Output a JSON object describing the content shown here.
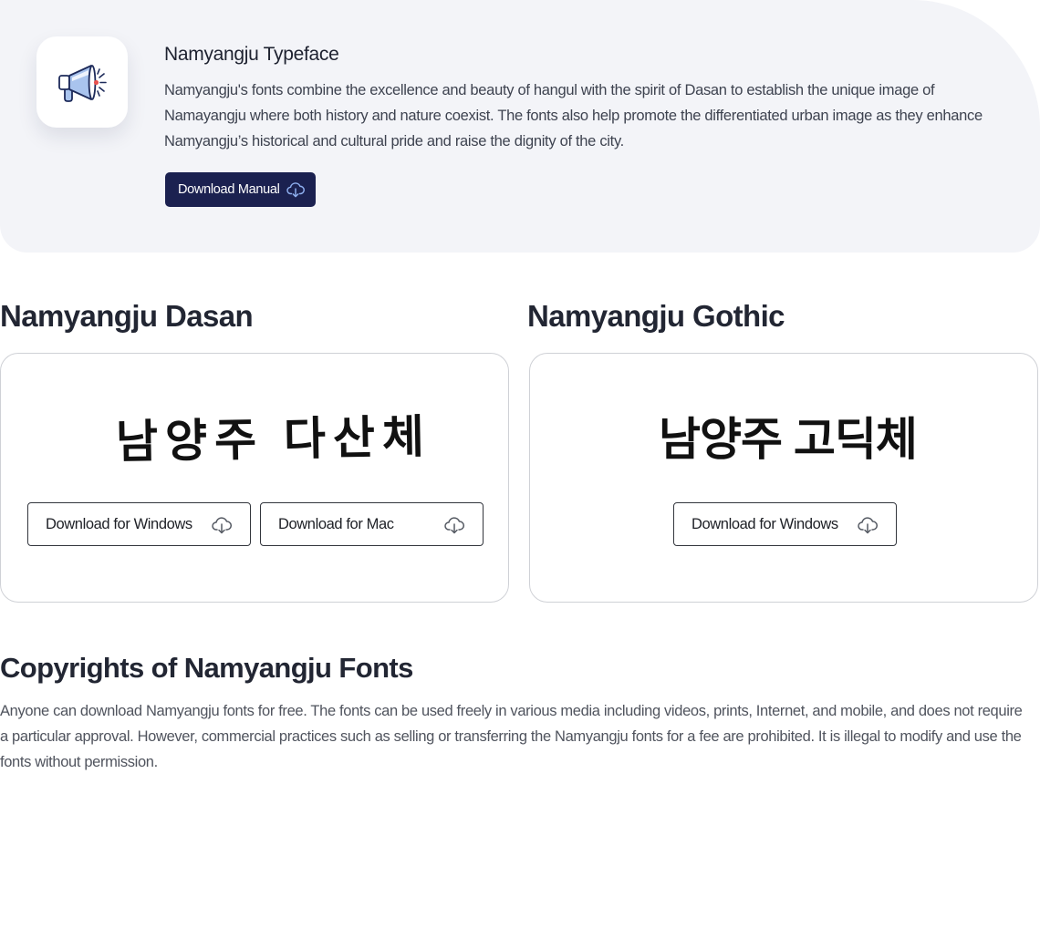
{
  "hero": {
    "title": "Namyangju Typeface",
    "description": "Namyangju's fonts combine the excellence and beauty of hangul with the spirit of Dasan to establish the unique image of Namayangju where both history and nature coexist. The fonts also help promote the differentiated urban image as they enhance Namyangju’s historical and cultural pride and raise the dignity of the city.",
    "download_manual_label": "Download Manual",
    "icon": "megaphone-icon"
  },
  "fonts": [
    {
      "name": "Namyangju Dasan",
      "preview": "남양주 다산체",
      "buttons": [
        "Download for Windows",
        "Download for Mac"
      ]
    },
    {
      "name": "Namyangju Gothic",
      "preview": "남양주 고딕체",
      "buttons": [
        "Download for Windows"
      ]
    }
  ],
  "copyright": {
    "title": "Copyrights of Namyangju Fonts",
    "text": "Anyone can download Namyangju fonts for free. The fonts can be used freely in various media including videos, prints, Internet, and mobile, and does not require a particular approval. However, commercial practices such as selling or transferring the Namyangju fonts for a fee are prohibited. It is illegal to modify and use the fonts without permission."
  },
  "colors": {
    "hero_bg": "#f3f4f8",
    "primary_button": "#1b2150",
    "heading": "#222633",
    "body_text": "#50545e"
  }
}
